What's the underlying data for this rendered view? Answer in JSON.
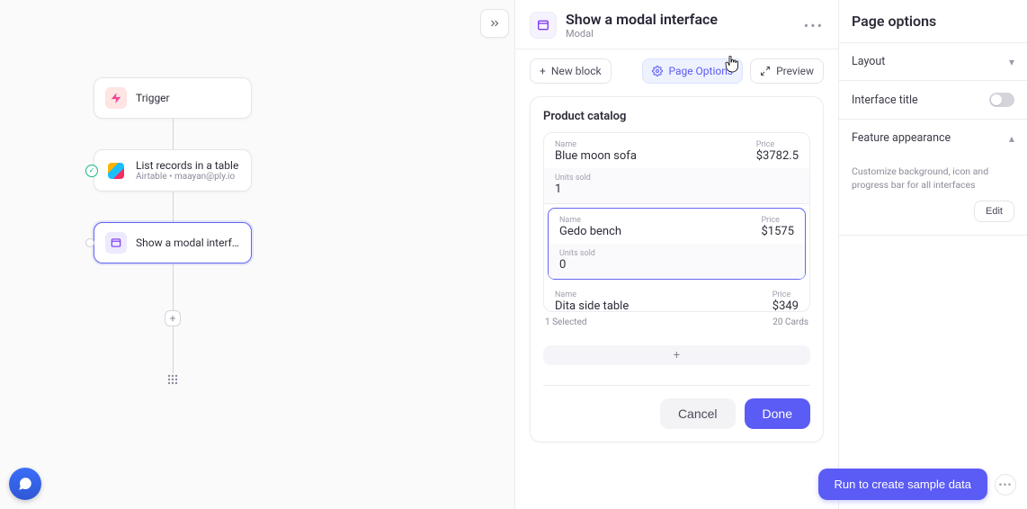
{
  "zoom": "100%",
  "flow": {
    "trigger": {
      "title": "Trigger"
    },
    "list": {
      "title": "List records in a table",
      "sub": "Airtable • maayan@ply.io"
    },
    "modal": {
      "title": "Show a modal interface"
    }
  },
  "detail": {
    "title": "Show a modal interface",
    "subtitle": "Modal",
    "toolbar": {
      "new_block": "New block",
      "page_options": "Page Options",
      "preview": "Preview"
    },
    "catalog_title": "Product catalog",
    "labels": {
      "name": "Name",
      "price": "Price",
      "units": "Units sold"
    },
    "cards": [
      {
        "name": "Blue moon sofa",
        "price": "$3782.5",
        "units": "1"
      },
      {
        "name": "Gedo bench",
        "price": "$1575",
        "units": "0"
      },
      {
        "name": "Dita side table",
        "price": "$349",
        "units": ""
      }
    ],
    "footer": {
      "selected": "1 Selected",
      "count": "20 Cards"
    },
    "buttons": {
      "cancel": "Cancel",
      "done": "Done"
    }
  },
  "options": {
    "title": "Page options",
    "layout": "Layout",
    "interface_title": "Interface title",
    "feature": {
      "title": "Feature appearance",
      "desc": "Customize background, icon and progress bar for all interfaces",
      "edit": "Edit"
    }
  },
  "run": {
    "label": "Run to create sample data"
  }
}
